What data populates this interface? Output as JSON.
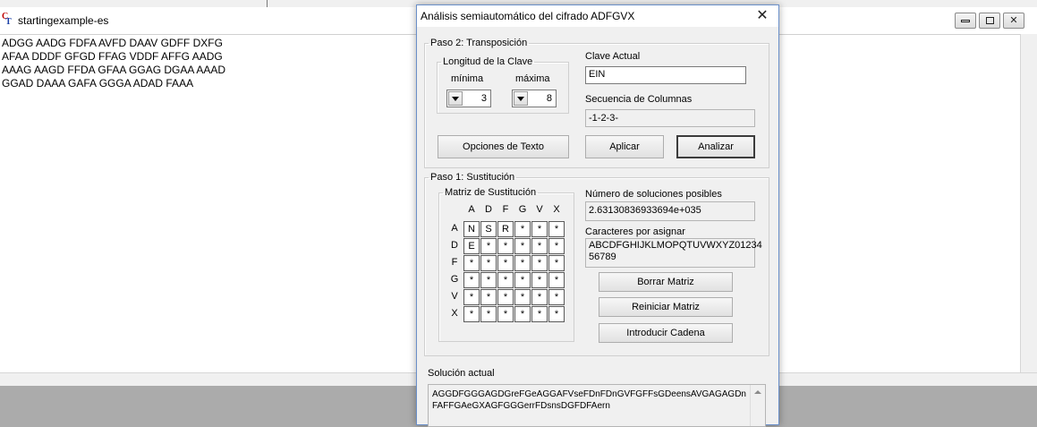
{
  "background_window": {
    "title": "startingexample-es",
    "lines": [
      "ADGG AADG FDFA AVFD DAAV GDFF DXFG",
      "AFAA DDDF GFGD FFAG VDDF AFFG AADG",
      "AAAG AAGD FFDA GFAA GGAG DGAA AAAD",
      "GGAD DAAA GAFA GGGA ADAD FAAA"
    ],
    "icons": [
      "app-logo",
      "minimize-icon",
      "restore-icon",
      "close-icon"
    ]
  },
  "dialog": {
    "title": "Análisis semiautomático del cifrado ADFGVX",
    "close_symbol": "✕",
    "paso2": {
      "legend": "Paso 2: Transposición",
      "longitud_legend": "Longitud de la Clave",
      "minima_label": "mínima",
      "maxima_label": "máxima",
      "minima_value": "3",
      "maxima_value": "8",
      "clave_actual_label": "Clave Actual",
      "clave_actual_value": "EIN",
      "secuencia_label": "Secuencia de Columnas",
      "secuencia_value": "-1-2-3-",
      "opciones_button": "Opciones de Texto",
      "aplicar_button": "Aplicar",
      "analizar_button": "Analizar"
    },
    "paso1": {
      "legend": "Paso 1: Sustitución",
      "matriz_legend": "Matriz de Sustitución",
      "col_headers": [
        "A",
        "D",
        "F",
        "G",
        "V",
        "X"
      ],
      "row_headers": [
        "A",
        "D",
        "F",
        "G",
        "V",
        "X"
      ],
      "cells": [
        [
          "N",
          "S",
          "R",
          "*",
          "*",
          "*"
        ],
        [
          "E",
          "*",
          "*",
          "*",
          "*",
          "*"
        ],
        [
          "*",
          "*",
          "*",
          "*",
          "*",
          "*"
        ],
        [
          "*",
          "*",
          "*",
          "*",
          "*",
          "*"
        ],
        [
          "*",
          "*",
          "*",
          "*",
          "*",
          "*"
        ],
        [
          "*",
          "*",
          "*",
          "*",
          "*",
          "*"
        ]
      ],
      "num_soluciones_label": "Número de soluciones posibles",
      "num_soluciones_value": "2.63130836933694e+035",
      "caracteres_label": "Caracteres por asignar",
      "caracteres_line1": "ABCDFGHIJKLMOPQTUVWXYZ01234",
      "caracteres_line2": "56789",
      "borrar_button": "Borrar Matriz",
      "reiniciar_button": "Reiniciar Matriz",
      "introducir_button": "Introducir Cadena"
    },
    "solucion_label": "Solución actual",
    "solucion_value": "AGGDFGGGAGDGreFGeAGGAFVseFDnFDnGVFGFFsGDeensAVGAGAGDnFAFFGAeGXAGFGGGerrFDsnsDGFDFAern"
  }
}
